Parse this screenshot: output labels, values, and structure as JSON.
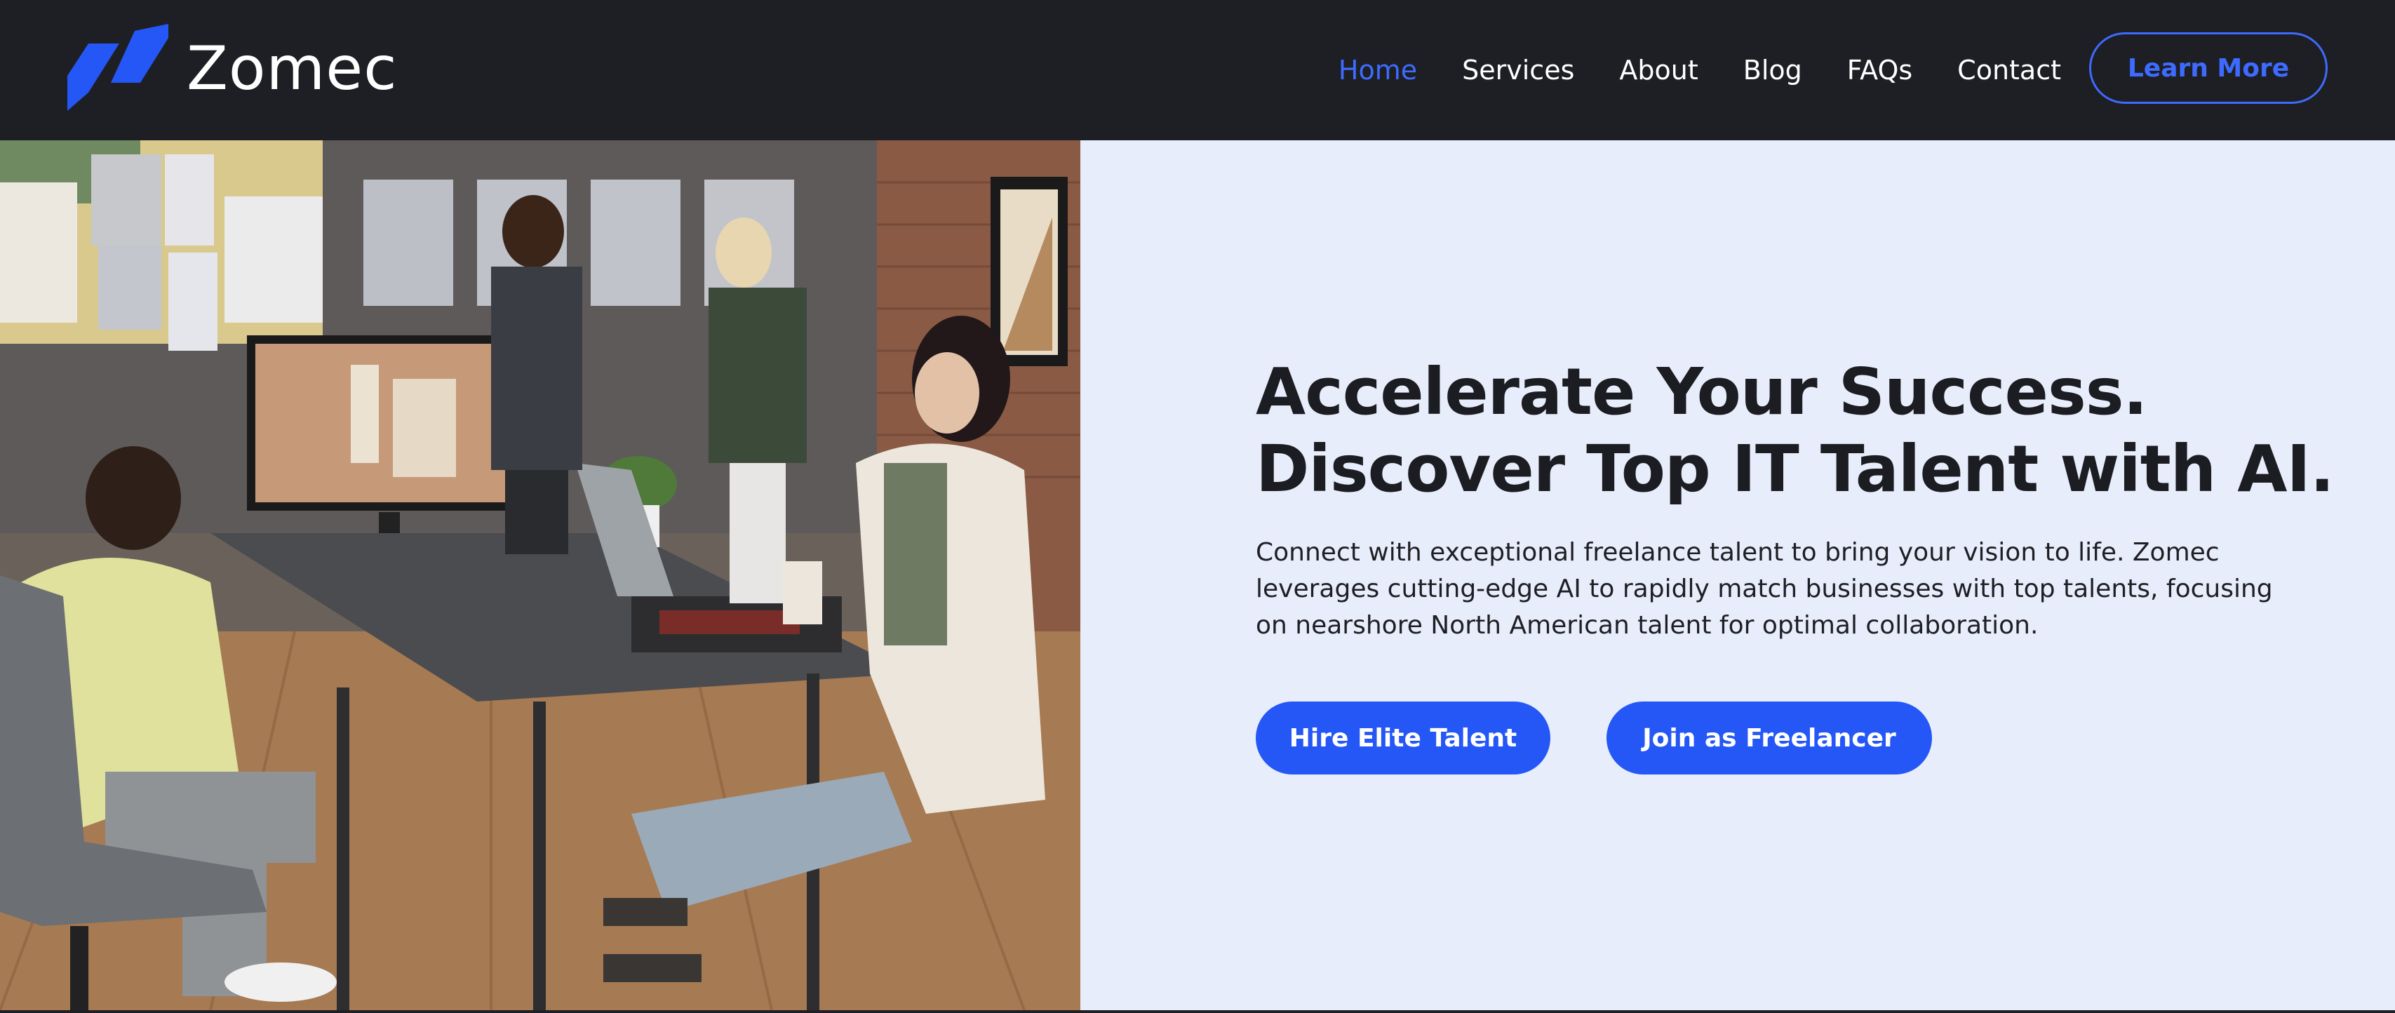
{
  "brand": {
    "name": "Zomec",
    "logo_icon": "zomec-slash-logo",
    "accent_color": "#2457f5"
  },
  "nav": {
    "items": [
      {
        "label": "Home",
        "active": true
      },
      {
        "label": "Services",
        "active": false
      },
      {
        "label": "About",
        "active": false
      },
      {
        "label": "Blog",
        "active": false
      },
      {
        "label": "FAQs",
        "active": false
      },
      {
        "label": "Contact",
        "active": false
      }
    ],
    "cta_label": "Learn More"
  },
  "hero": {
    "image_alt": "team-working-in-office-photo",
    "headline": "Accelerate Your Success. Discover Top IT Talent with AI.",
    "subtext": "Connect with exceptional freelance talent to bring your vision to life. Zomec leverages cutting-edge AI to rapidly match businesses with top talents, focusing on nearshore North American talent for optimal collaboration.",
    "primary_button": "Hire Elite Talent",
    "secondary_button": "Join as Freelancer",
    "background_color": "#e8edfb"
  }
}
